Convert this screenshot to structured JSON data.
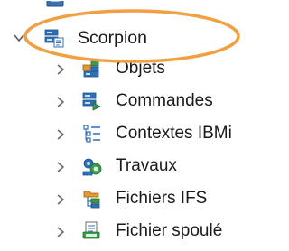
{
  "tree": {
    "root": {
      "label": "Scorpion",
      "icon": "connection-icon",
      "expanded": true
    },
    "children": [
      {
        "label": "Objets",
        "icon": "objects-icon"
      },
      {
        "label": "Commandes",
        "icon": "commands-icon"
      },
      {
        "label": "Contextes IBMi",
        "icon": "contexts-icon"
      },
      {
        "label": "Travaux",
        "icon": "jobs-icon"
      },
      {
        "label": "Fichiers IFS",
        "icon": "ifs-files-icon"
      },
      {
        "label": "Fichier spoulé",
        "icon": "spooled-file-icon"
      }
    ]
  },
  "colors": {
    "highlight_ring": "#f0a040",
    "twisty": "#6b6b6b",
    "icon_blue": "#2f6fb8",
    "icon_green": "#3d9a4a",
    "icon_orange": "#e39b2d"
  }
}
